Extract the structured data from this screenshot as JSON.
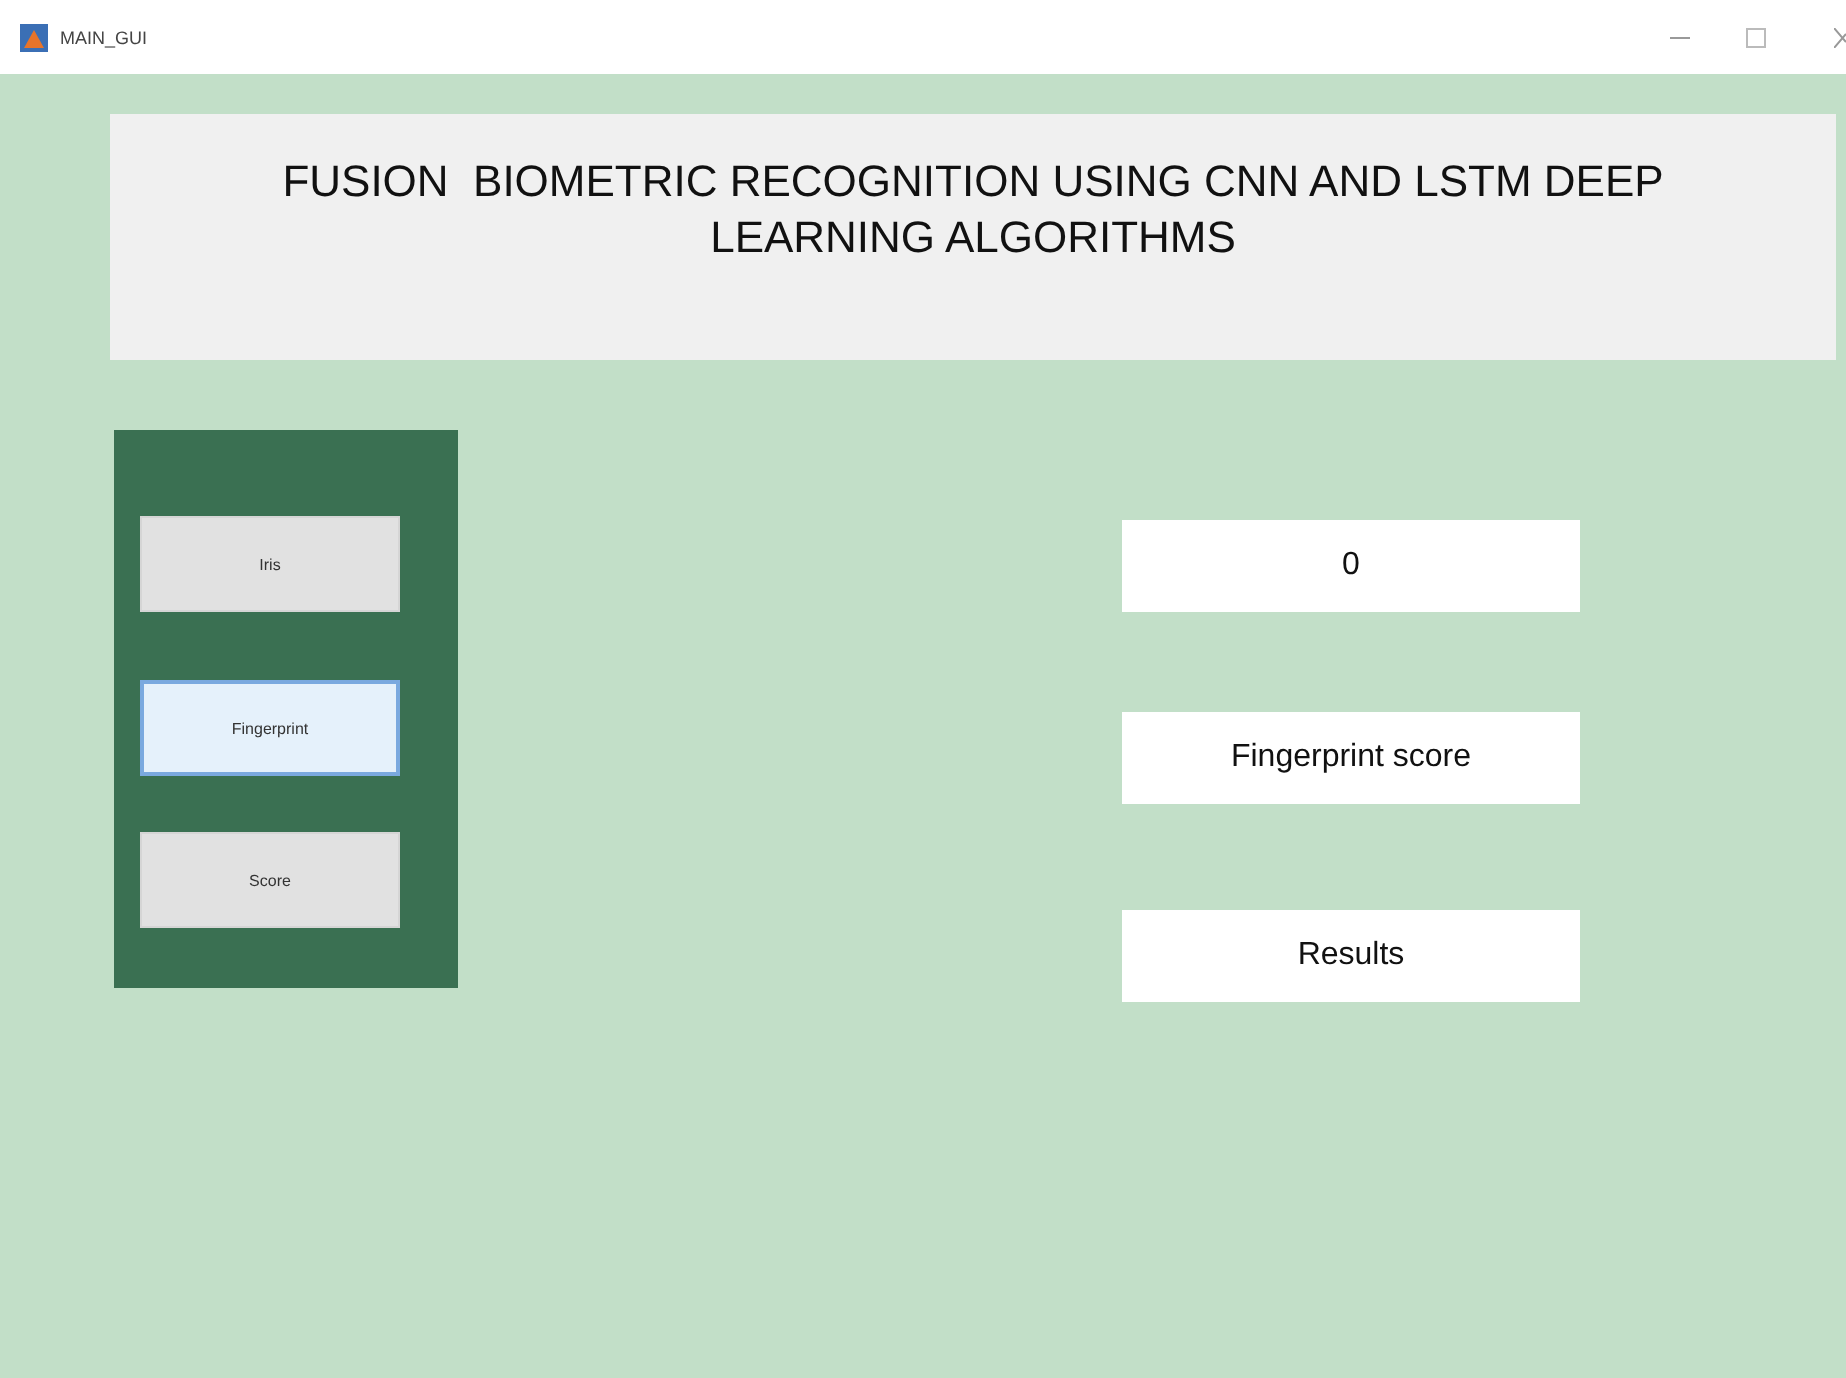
{
  "window": {
    "title": "MAIN_GUI"
  },
  "heading": "FUSION  BIOMETRIC RECOGNITION USING CNN AND LSTM DEEP LEARNING ALGORITHMS",
  "buttons": [
    {
      "label": "Iris",
      "selected": false
    },
    {
      "label": "Fingerprint",
      "selected": true
    },
    {
      "label": "Score",
      "selected": false
    }
  ],
  "outputs": [
    "0",
    "Fingerprint score",
    "Results"
  ]
}
